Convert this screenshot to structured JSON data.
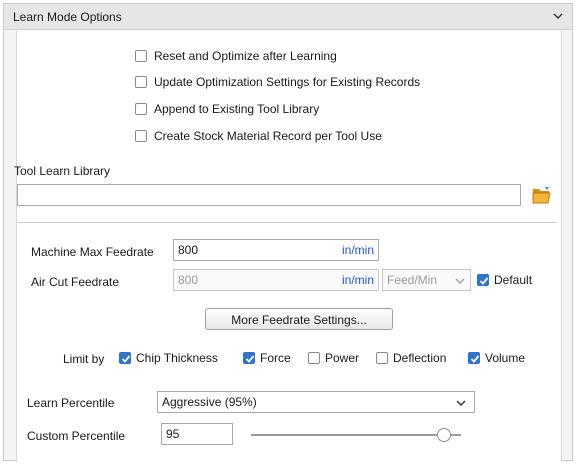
{
  "panel": {
    "title": "Learn Mode Options"
  },
  "options": [
    {
      "label": "Reset and Optimize after Learning",
      "checked": false
    },
    {
      "label": "Update Optimization Settings for Existing Records",
      "checked": false
    },
    {
      "label": "Append to Existing Tool Library",
      "checked": false
    },
    {
      "label": "Create Stock Material Record per Tool Use",
      "checked": false
    }
  ],
  "tool_library": {
    "label": "Tool Learn Library",
    "value": "",
    "browse_icon": "folder-open-icon"
  },
  "machine_max": {
    "label": "Machine Max Feedrate",
    "value": "800",
    "unit": "in/min"
  },
  "air_cut": {
    "label": "Air Cut Feedrate",
    "value": "800",
    "unit": "in/min",
    "mode": "Feed/Min",
    "default_label": "Default",
    "default_checked": true
  },
  "more_button": {
    "label": "More Feedrate Settings..."
  },
  "limit_by": {
    "label": "Limit by",
    "items": [
      {
        "label": "Chip Thickness",
        "checked": true
      },
      {
        "label": "Force",
        "checked": true
      },
      {
        "label": "Power",
        "checked": false
      },
      {
        "label": "Deflection",
        "checked": false
      },
      {
        "label": "Volume",
        "checked": true
      }
    ]
  },
  "learn_percentile": {
    "label": "Learn Percentile",
    "value": "Aggressive (95%)"
  },
  "custom_percentile": {
    "label": "Custom Percentile",
    "value": "95",
    "slider_fraction": 0.95
  },
  "colors": {
    "accent": "#2f74c8",
    "unit": "#2255cc",
    "folder": "#e8a317"
  }
}
